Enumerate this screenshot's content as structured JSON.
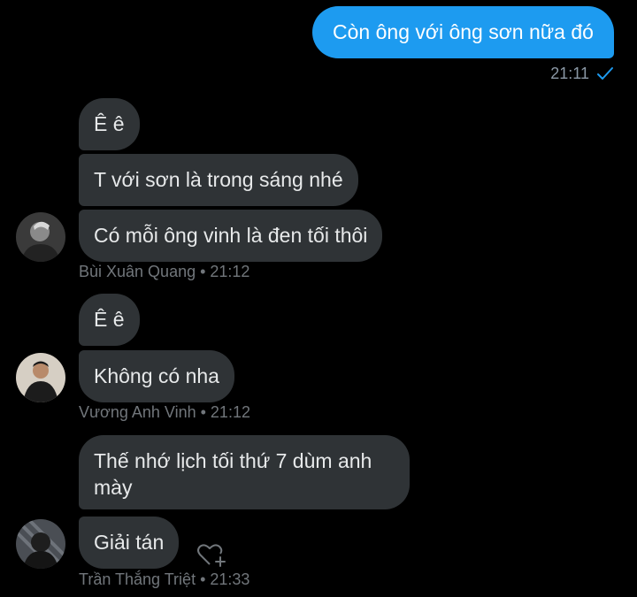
{
  "outgoing": {
    "text": "Còn ông với ông sơn nữa đó",
    "time": "21:11",
    "status_icon": "check-icon",
    "color": "#1d9bf0"
  },
  "groups": [
    {
      "sender": "Bùi Xuân Quang",
      "time": "21:12",
      "meta": "Bùi Xuân Quang • 21:12",
      "messages": [
        "Ê ê",
        "T với sơn là trong sáng nhé",
        "Có mỗi ông vinh là đen tối thôi"
      ]
    },
    {
      "sender": "Vương Anh Vinh",
      "time": "21:12",
      "meta": "Vương Anh Vinh • 21:12",
      "messages": [
        "Ê ê",
        "Không có nha"
      ]
    },
    {
      "sender": "Trần Thắng Triệt",
      "time": "21:33",
      "meta": "Trần Thắng Triệt • 21:33",
      "messages": [
        "Thế nhớ lịch tối thứ 7 dùm anh mày",
        "Giải tán"
      ]
    }
  ],
  "icons": {
    "react": "heart-plus-icon"
  },
  "colors": {
    "background": "#000000",
    "incoming_bubble": "#2f3336",
    "meta_text": "#71767b"
  }
}
